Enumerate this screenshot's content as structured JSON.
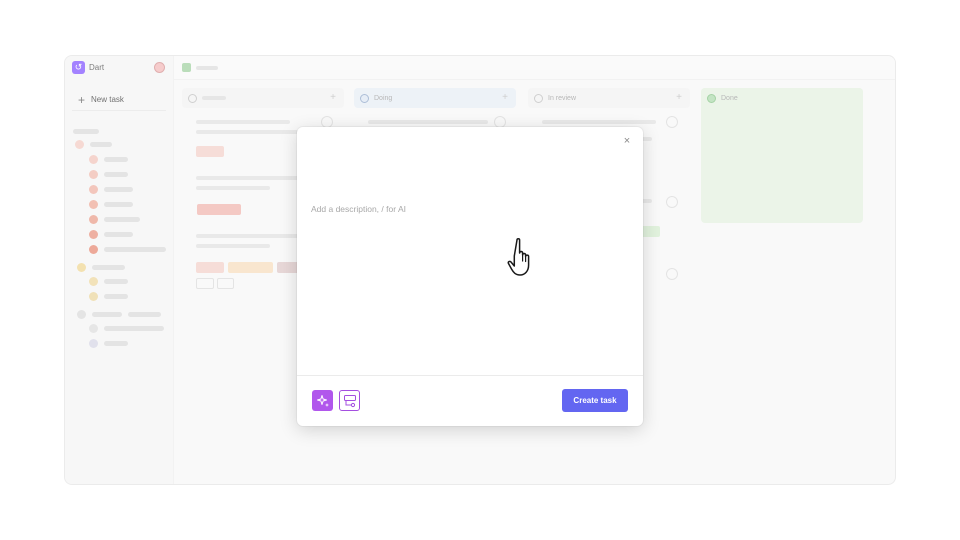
{
  "sidebar": {
    "workspace_name": "Dart",
    "logo_glyph": "↺",
    "new_task_label": "New task"
  },
  "board": {
    "columns": [
      {
        "label": "",
        "color": "#f1f1f1"
      },
      {
        "label": "Doing",
        "color": "#e5ecf4"
      },
      {
        "label": "In review",
        "color": "#f1f1f1"
      },
      {
        "label": "Done",
        "color": "#e2efdf"
      }
    ]
  },
  "modal": {
    "close_glyph": "×",
    "description_placeholder": "Add a description, / for AI",
    "create_label": "Create task"
  },
  "colors": {
    "accent": "#6366f1",
    "ai_purple": "#b157ec"
  },
  "icons": {
    "close": "close-icon",
    "ai": "sparkle-icon",
    "template": "template-icon",
    "cursor": "hand-pointer-icon"
  }
}
